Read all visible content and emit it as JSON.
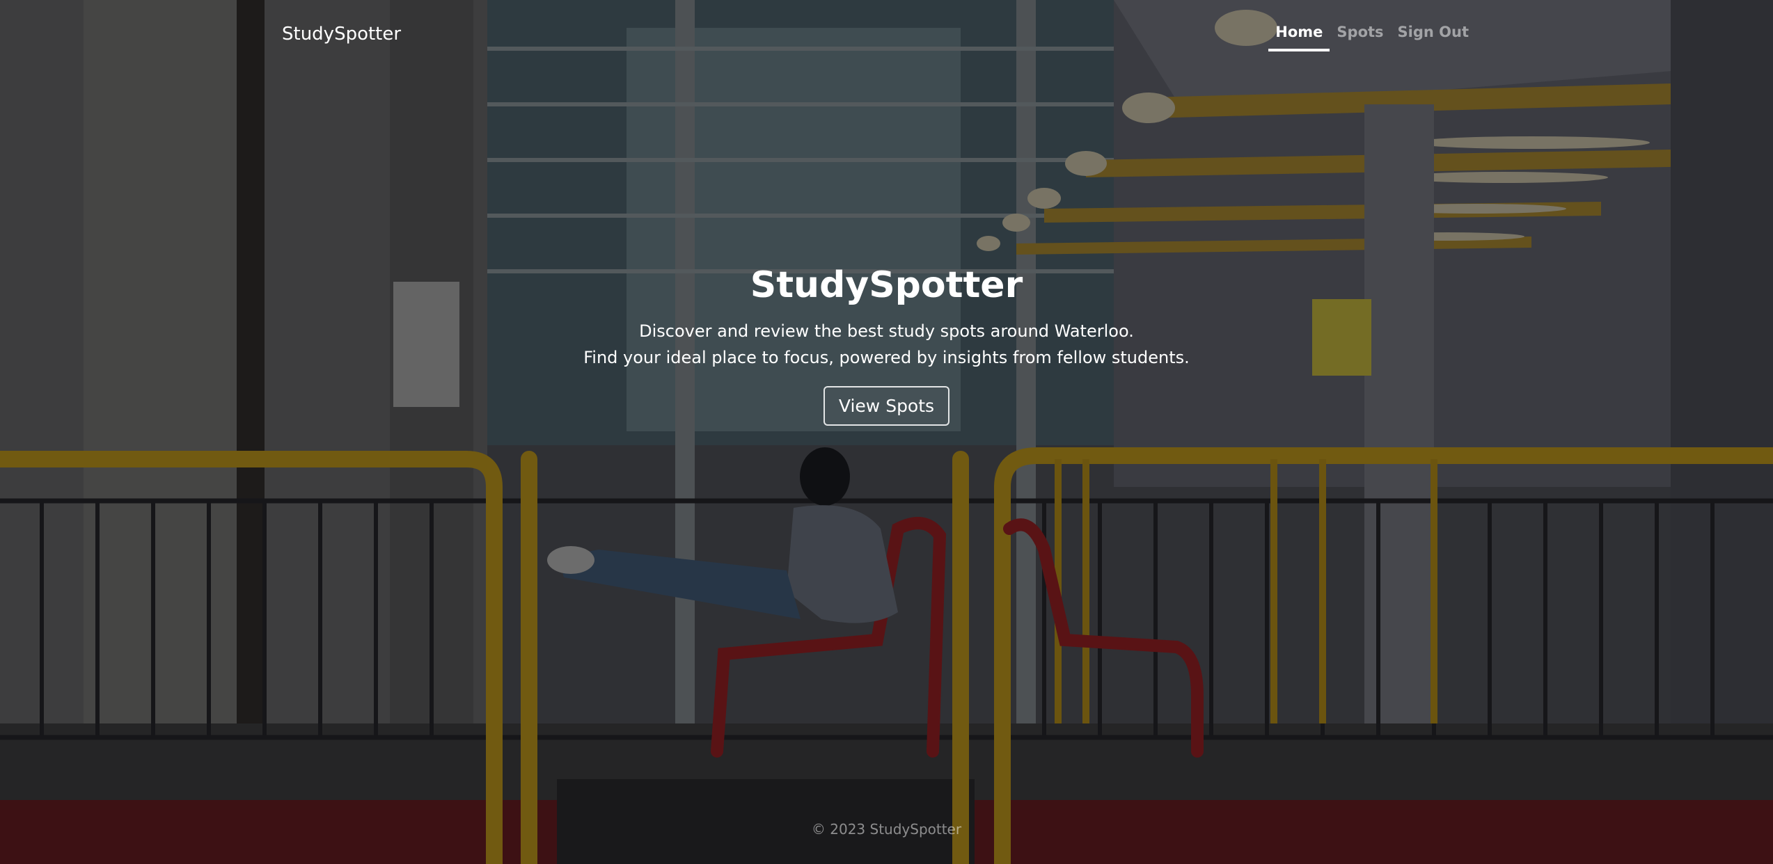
{
  "navbar": {
    "brand": "StudySpotter",
    "links": [
      {
        "label": "Home",
        "active": true
      },
      {
        "label": "Spots",
        "active": false
      },
      {
        "label": "Sign Out",
        "active": false
      }
    ]
  },
  "hero": {
    "title": "StudySpotter",
    "lead_line_1": "Discover and review the best study spots around Waterloo.",
    "lead_line_2": "Find your ideal place to focus, powered by insights from fellow students.",
    "cta_label": "View Spots"
  },
  "footer": {
    "text": "© 2023 StudySpotter"
  },
  "colors": {
    "text": "#ffffff",
    "muted_text": "rgba(255,255,255,0.5)",
    "overlay": "rgba(0,0,0,0.5)",
    "railing_yellow": "#e2b422",
    "bench_red": "#b3262b"
  }
}
